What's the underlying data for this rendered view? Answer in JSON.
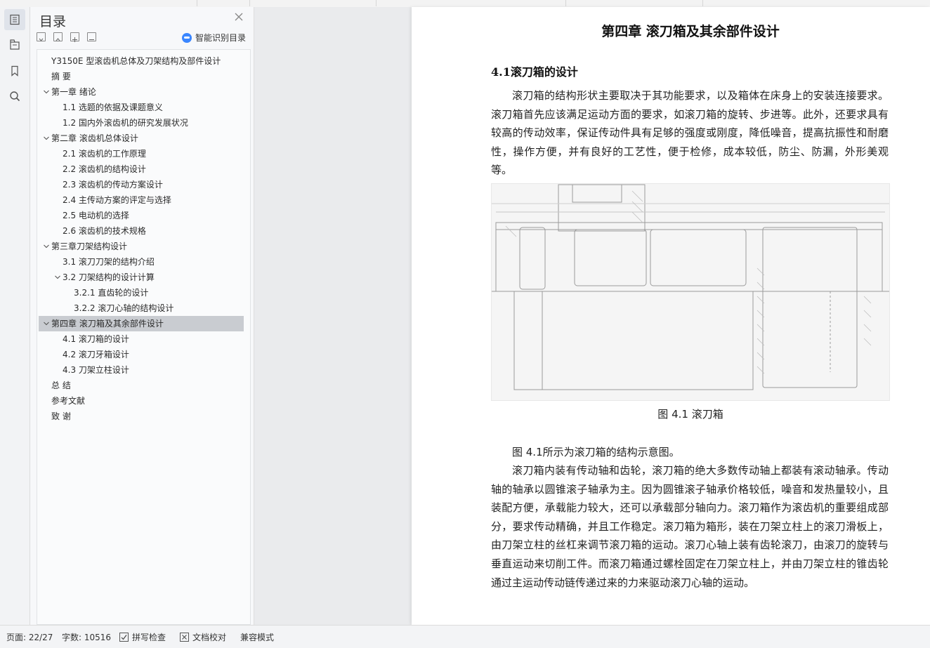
{
  "toc": {
    "title": "目录",
    "smart_label": "智能识别目录",
    "items": [
      {
        "label": "Y3150E 型滚齿机总体及刀架结构及部件设计",
        "level": 0,
        "expand": false
      },
      {
        "label": "摘  要",
        "level": 0,
        "expand": false
      },
      {
        "label": "第一章  绪论",
        "level": 0,
        "expand": true
      },
      {
        "label": "1.1 选题的依据及课题意义",
        "level": 1,
        "expand": false
      },
      {
        "label": "1.2 国内外滚齿机的研究发展状况",
        "level": 1,
        "expand": false
      },
      {
        "label": "第二章  滚齿机总体设计",
        "level": 0,
        "expand": true
      },
      {
        "label": "2.1 滚齿机的工作原理",
        "level": 1,
        "expand": false
      },
      {
        "label": "2.2  滚齿机的结构设计",
        "level": 1,
        "expand": false
      },
      {
        "label": "2.3  滚齿机的传动方案设计",
        "level": 1,
        "expand": false
      },
      {
        "label": "2.4 主传动方案的评定与选择",
        "level": 1,
        "expand": false
      },
      {
        "label": "2.5 电动机的选择",
        "level": 1,
        "expand": false
      },
      {
        "label": "2.6 滚齿机的技术规格",
        "level": 1,
        "expand": false
      },
      {
        "label": "第三章刀架结构设计",
        "level": 0,
        "expand": true
      },
      {
        "label": "3.1 滚刀刀架的结构介绍",
        "level": 1,
        "expand": false
      },
      {
        "label": "3.2  刀架结构的设计计算",
        "level": 1,
        "expand": true
      },
      {
        "label": "3.2.1  直齿轮的设计",
        "level": 2,
        "expand": false
      },
      {
        "label": "3.2.2  滚刀心轴的结构设计",
        "level": 2,
        "expand": false
      },
      {
        "label": "第四章  滚刀箱及其余部件设计",
        "level": 0,
        "expand": true,
        "selected": true
      },
      {
        "label": "4.1 滚刀箱的设计",
        "level": 1,
        "expand": false
      },
      {
        "label": "4.2  滚刀牙箱设计",
        "level": 1,
        "expand": false
      },
      {
        "label": "4.3  刀架立柱设计",
        "level": 1,
        "expand": false
      },
      {
        "label": "总      结",
        "level": 0,
        "expand": false
      },
      {
        "label": "参考文献",
        "level": 0,
        "expand": false
      },
      {
        "label": "致      谢",
        "level": 0,
        "expand": false
      }
    ]
  },
  "doc": {
    "chapter_title": "第四章  滚刀箱及其余部件设计",
    "section_title": "4.1滚刀箱的设计",
    "para1": "滚刀箱的结构形状主要取决于其功能要求，以及箱体在床身上的安装连接要求。滚刀箱首先应该满足运动方面的要求，如滚刀箱的旋转、步进等。此外，还要求具有较高的传动效率，保证传动件具有足够的强度或刚度，降低噪音，提高抗振性和耐磨性，操作方便，并有良好的工艺性，便于检修，成本较低，防尘、防漏，外形美观等。",
    "figure_caption": "图 4.1  滚刀箱",
    "para2": "图 4.1所示为滚刀箱的结构示意图。",
    "para3": "滚刀箱内装有传动轴和齿轮，滚刀箱的绝大多数传动轴上都装有滚动轴承。传动轴的轴承以圆锥滚子轴承为主。因为圆锥滚子轴承价格较低，噪音和发热量较小，且装配方便，承载能力较大，还可以承载部分轴向力。滚刀箱作为滚齿机的重要组成部分，要求传动精确，并且工作稳定。滚刀箱为箱形，装在刀架立柱上的滚刀滑板上，由刀架立柱的丝杠来调节滚刀箱的运动。滚刀心轴上装有齿轮滚刀，由滚刀的旋转与垂直运动来切削工件。而滚刀箱通过螺栓固定在刀架立柱上，并由刀架立柱的锥齿轮通过主运动传动链传递过来的力来驱动滚刀心轴的运动。"
  },
  "status": {
    "page": "页面: 22/27",
    "words": "字数: 10516",
    "spell": "拼写检查",
    "proof": "文档校对",
    "compat": "兼容模式"
  }
}
